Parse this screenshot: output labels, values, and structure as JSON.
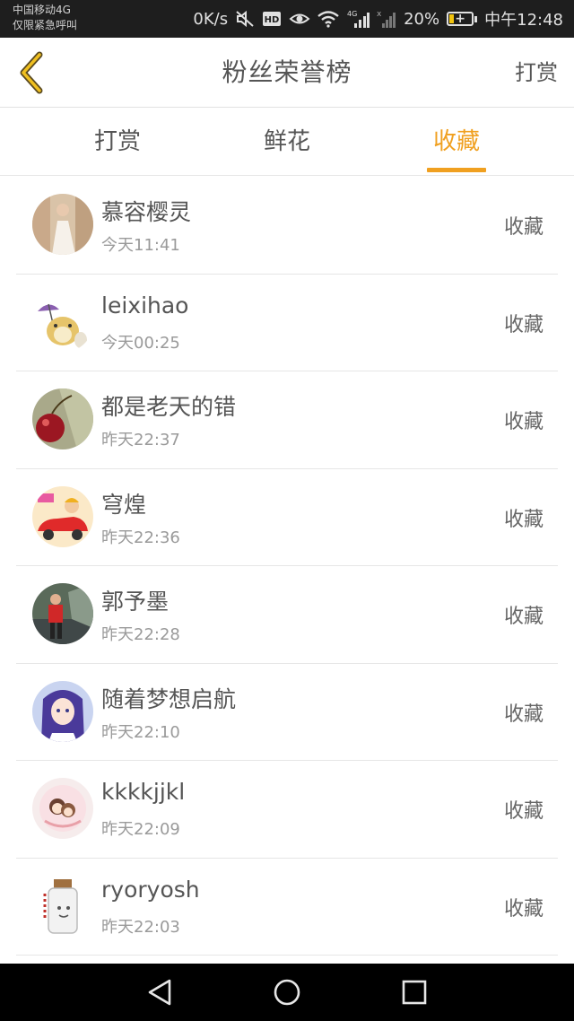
{
  "status_bar": {
    "carrier_line1": "中国移动4G",
    "carrier_line2": "仅限紧急呼叫",
    "net_speed": "0K/s",
    "hd_badge": "HD",
    "signal_4g": "4G",
    "battery_percent": "20%",
    "battery_level": 0.2,
    "time": "中午12:48",
    "icons": [
      "mute-icon",
      "hd-icon",
      "eye-icon",
      "wifi-icon",
      "signal-icon",
      "no-signal-icon",
      "battery-icon"
    ]
  },
  "header": {
    "title": "粉丝荣誉榜",
    "action_label": "打赏",
    "back_icon": "chevron-left-icon"
  },
  "tabs": [
    {
      "label": "打赏",
      "active": false
    },
    {
      "label": "鲜花",
      "active": false
    },
    {
      "label": "收藏",
      "active": true
    }
  ],
  "accent_color": "#f0a020",
  "list": [
    {
      "name": "慕容樱灵",
      "time": "今天11:41",
      "action": "收藏"
    },
    {
      "name": "leixihao",
      "time": "今天00:25",
      "action": "收藏"
    },
    {
      "name": "都是老天的错",
      "time": "昨天22:37",
      "action": "收藏"
    },
    {
      "name": "穹煌",
      "time": "昨天22:36",
      "action": "收藏"
    },
    {
      "name": "郭予墨",
      "time": "昨天22:28",
      "action": "收藏"
    },
    {
      "name": "随着梦想启航",
      "time": "昨天22:10",
      "action": "收藏"
    },
    {
      "name": "kkkkjjkl",
      "time": "昨天22:09",
      "action": "收藏"
    },
    {
      "name": "ryoryosh",
      "time": "昨天22:03",
      "action": "收藏"
    }
  ],
  "nav_bar": {
    "icons": [
      "back-triangle-icon",
      "home-circle-icon",
      "recents-square-icon"
    ]
  }
}
